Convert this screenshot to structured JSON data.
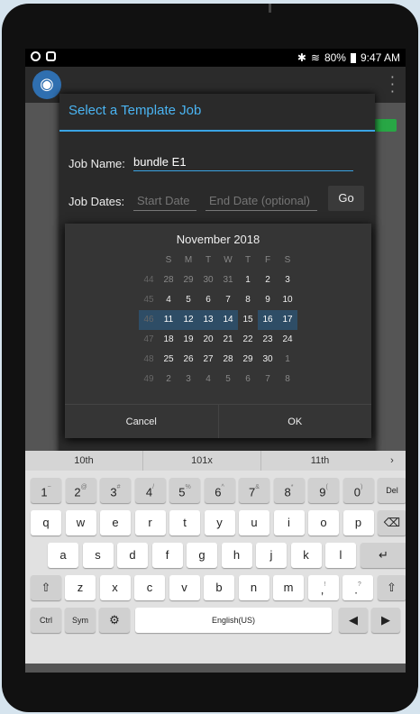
{
  "status_bar": {
    "battery": "80%",
    "time": "9:47 AM",
    "bluetooth_icon": "bluetooth-icon",
    "wifi_icon": "wifi-icon"
  },
  "dialog": {
    "title": "Select a Template Job",
    "job_name_label": "Job Name:",
    "job_name_value": "bundle E1",
    "job_dates_label": "Job Dates:",
    "start_date_placeholder": "Start Date",
    "end_date_placeholder": "End Date (optional)",
    "go_label": "Go"
  },
  "calendar": {
    "title": "November 2018",
    "weekdays": [
      "S",
      "M",
      "T",
      "W",
      "T",
      "F",
      "S"
    ],
    "weeks": [
      {
        "week": "44",
        "days": [
          "28",
          "29",
          "30",
          "31",
          "1",
          "2",
          "3"
        ]
      },
      {
        "week": "45",
        "days": [
          "4",
          "5",
          "6",
          "7",
          "8",
          "9",
          "10"
        ]
      },
      {
        "week": "46",
        "days": [
          "11",
          "12",
          "13",
          "14",
          "15",
          "16",
          "17"
        ]
      },
      {
        "week": "47",
        "days": [
          "18",
          "19",
          "20",
          "21",
          "22",
          "23",
          "24"
        ]
      },
      {
        "week": "48",
        "days": [
          "25",
          "26",
          "27",
          "28",
          "29",
          "30",
          "1"
        ]
      },
      {
        "week": "49",
        "days": [
          "2",
          "3",
          "4",
          "5",
          "6",
          "7",
          "8"
        ]
      }
    ],
    "cancel_label": "Cancel",
    "ok_label": "OK"
  },
  "keyboard": {
    "suggestions": [
      "10th",
      "101x",
      "11th"
    ],
    "suggest_more": "›",
    "row_numbers": [
      {
        "k": "1",
        "s": "~"
      },
      {
        "k": "2",
        "s": "@"
      },
      {
        "k": "3",
        "s": "#"
      },
      {
        "k": "4",
        "s": "/"
      },
      {
        "k": "5",
        "s": "%"
      },
      {
        "k": "6",
        "s": "^"
      },
      {
        "k": "7",
        "s": "&"
      },
      {
        "k": "8",
        "s": "*"
      },
      {
        "k": "9",
        "s": "("
      },
      {
        "k": "0",
        "s": ")"
      }
    ],
    "del_label": "Del",
    "row_q": [
      "q",
      "w",
      "e",
      "r",
      "t",
      "y",
      "u",
      "i",
      "o",
      "p"
    ],
    "row_a": [
      "a",
      "s",
      "d",
      "f",
      "g",
      "h",
      "j",
      "k",
      "l"
    ],
    "row_z": [
      "z",
      "x",
      "c",
      "v",
      "b",
      "n",
      "m"
    ],
    "comma": ",",
    "comma_sup": "!",
    "period": ".",
    "period_sup": "?",
    "ctrl_label": "Ctrl",
    "sym_label": "Sym",
    "space_label": "English(US)"
  }
}
